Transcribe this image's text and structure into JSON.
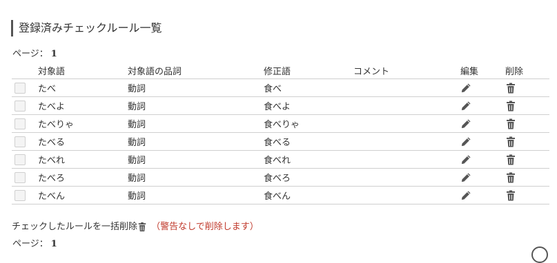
{
  "section": {
    "title": "登録済みチェックルール一覧"
  },
  "pagination": {
    "label": "ページ：",
    "page": "1"
  },
  "table": {
    "headers": {
      "word": "対象語",
      "pos": "対象語の品詞",
      "fix": "修正語",
      "comment": "コメント",
      "edit": "編集",
      "delete": "削除"
    },
    "rows": [
      {
        "word": "たべ",
        "pos": "動詞",
        "fix": "食べ",
        "comment": ""
      },
      {
        "word": "たべよ",
        "pos": "動詞",
        "fix": "食べよ",
        "comment": ""
      },
      {
        "word": "たべりゃ",
        "pos": "動詞",
        "fix": "食べりゃ",
        "comment": ""
      },
      {
        "word": "たべる",
        "pos": "動詞",
        "fix": "食べる",
        "comment": ""
      },
      {
        "word": "たべれ",
        "pos": "動詞",
        "fix": "食べれ",
        "comment": ""
      },
      {
        "word": "たべろ",
        "pos": "動詞",
        "fix": "食べろ",
        "comment": ""
      },
      {
        "word": "たべん",
        "pos": "動詞",
        "fix": "食べん",
        "comment": ""
      }
    ]
  },
  "bulk": {
    "label": "チェックしたルールを一括削除",
    "warning": "（警告なしで削除します）"
  },
  "icons": {
    "edit": "pencil-icon",
    "delete": "trash-icon"
  },
  "colors": {
    "warning": "#c0392b",
    "icon": "#555555",
    "border": "#cfcfcf"
  }
}
